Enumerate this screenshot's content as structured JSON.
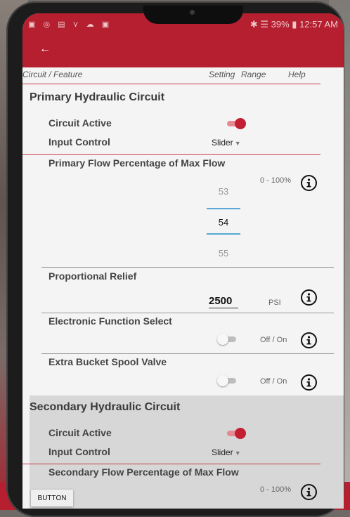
{
  "status_bar": {
    "left_icons": "▣ ◎ ▤ ⋎ ☁ ▣",
    "right_text": "✱ ☰ 39% ▮ 12:57 AM"
  },
  "header": {
    "back_icon": "←"
  },
  "columns": {
    "feature": "Circuit / Feature",
    "setting": "Setting",
    "range": "Range",
    "help": "Help"
  },
  "primary": {
    "title": "Primary Hydraulic Circuit",
    "circuit_active_label": "Circuit Active",
    "circuit_active": true,
    "input_control_label": "Input Control",
    "input_control_value": "Slider",
    "flow": {
      "label": "Primary Flow Percentage of Max Flow",
      "range": "0 - 100%",
      "prev": "53",
      "value": "54",
      "next": "55"
    },
    "relief": {
      "label": "Proportional Relief",
      "value": "2500",
      "unit": "PSI"
    },
    "electronic": {
      "label": "Electronic Function Select",
      "enabled": false,
      "range": "Off / On"
    },
    "bucket": {
      "label": "Extra Bucket Spool Valve",
      "enabled": false,
      "range": "Off / On"
    }
  },
  "secondary": {
    "title": "Secondary Hydraulic Circuit",
    "circuit_active_label": "Circuit Active",
    "circuit_active": true,
    "input_control_label": "Input Control",
    "input_control_value": "Slider",
    "flow_label": "Secondary Flow Percentage of Max Flow",
    "flow_range": "0 - 100%"
  },
  "footer_button": "BUTTON",
  "colors": {
    "accent": "#b51f30",
    "toggle_on": "#c21f33",
    "picker_line": "#5aa7d8"
  }
}
